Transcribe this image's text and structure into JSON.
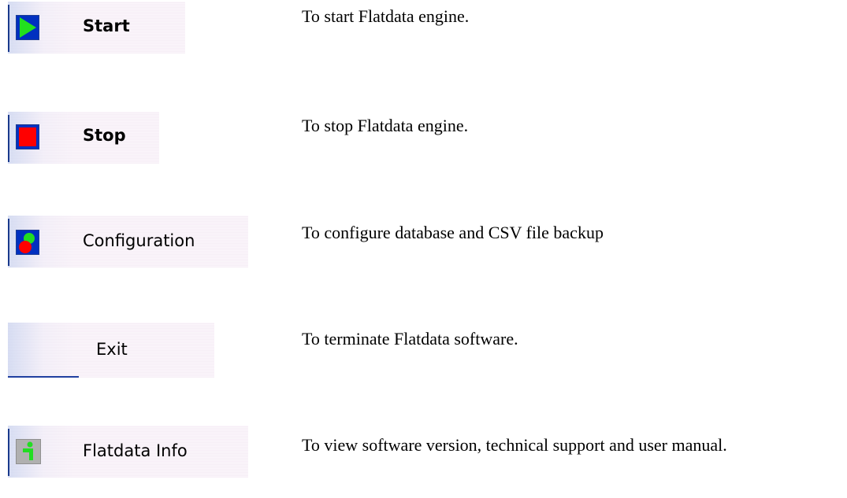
{
  "items": [
    {
      "button_label": "Start",
      "icon": "play-icon",
      "description": "To start Flatdata engine."
    },
    {
      "button_label": "Stop",
      "icon": "stop-icon",
      "description": "To stop Flatdata engine."
    },
    {
      "button_label": "Configuration",
      "icon": "configuration-icon",
      "description": "To configure database and CSV file backup"
    },
    {
      "button_label": "Exit",
      "icon": "",
      "description": "To terminate Flatdata software."
    },
    {
      "button_label": "Flatdata Info",
      "icon": "info-icon",
      "description": "To view software version, technical support and user manual."
    }
  ],
  "colors": {
    "play_green": "#22e01e",
    "stop_red": "#ff0000",
    "icon_blue": "#0030c0",
    "info_green": "#22dd22"
  }
}
